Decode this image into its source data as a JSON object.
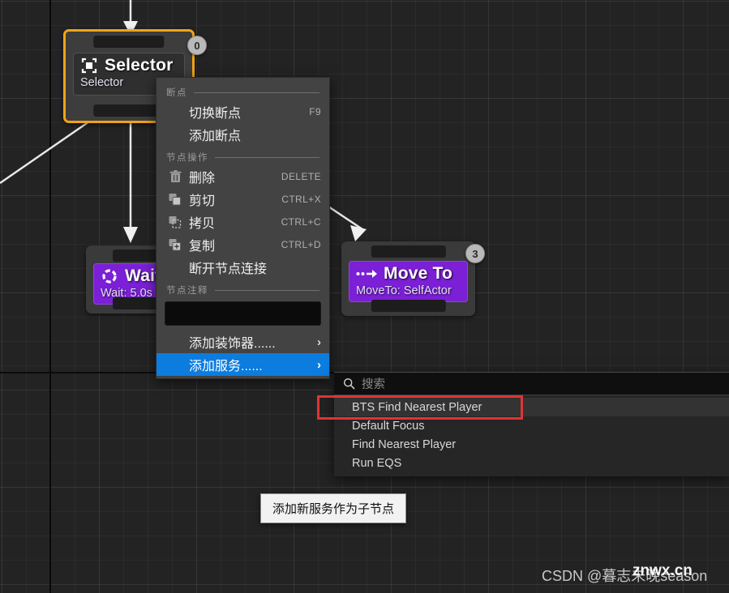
{
  "canvas": {
    "name": "behavior-tree-graph"
  },
  "nodes": [
    {
      "id": "selector",
      "title": "Selector",
      "subtitle": "Selector",
      "index": "0",
      "icon": "selector-icon",
      "color": "#f0a318"
    },
    {
      "id": "wait",
      "title": "Wait",
      "subtitle": "Wait: 5.0s",
      "index": "",
      "icon": "wait-icon",
      "color": "#7b20d6"
    },
    {
      "id": "moveto",
      "title": "Move To",
      "subtitle": "MoveTo: SelfActor",
      "index": "3",
      "icon": "moveto-icon",
      "color": "#7b20d6"
    }
  ],
  "context_menu": {
    "sections": [
      {
        "label": "断点"
      },
      {
        "label": "节点操作"
      },
      {
        "label": "节点注释"
      }
    ],
    "items": [
      {
        "label": "切换断点",
        "shortcut": "F9",
        "icon": ""
      },
      {
        "label": "添加断点",
        "shortcut": "",
        "icon": ""
      },
      {
        "label": "删除",
        "shortcut": "DELETE",
        "icon": "trash-icon"
      },
      {
        "label": "剪切",
        "shortcut": "CTRL+X",
        "icon": "cut-icon"
      },
      {
        "label": "拷贝",
        "shortcut": "CTRL+C",
        "icon": "copy-icon"
      },
      {
        "label": "复制",
        "shortcut": "CTRL+D",
        "icon": "duplicate-icon"
      },
      {
        "label": "断开节点连接",
        "shortcut": "",
        "icon": ""
      },
      {
        "label": "添加装饰器......",
        "shortcut": "",
        "icon": "",
        "arrow": "›"
      },
      {
        "label": "添加服务......",
        "shortcut": "",
        "icon": "",
        "arrow": "›"
      }
    ],
    "note_field_value": "",
    "highlight_color": "#0c7cdf"
  },
  "service_submenu": {
    "search_placeholder": "搜索",
    "search_value": "",
    "items": [
      {
        "label": "BTS Find Nearest Player"
      },
      {
        "label": "Default Focus"
      },
      {
        "label": "Find Nearest Player"
      },
      {
        "label": "Run EQS"
      }
    ]
  },
  "annotation": {
    "color": "#e03434"
  },
  "tooltip": {
    "text": "添加新服务作为子节点"
  },
  "watermarks": {
    "csdn": "CSDN @暮志未晚season",
    "site": "znwx.cn"
  }
}
